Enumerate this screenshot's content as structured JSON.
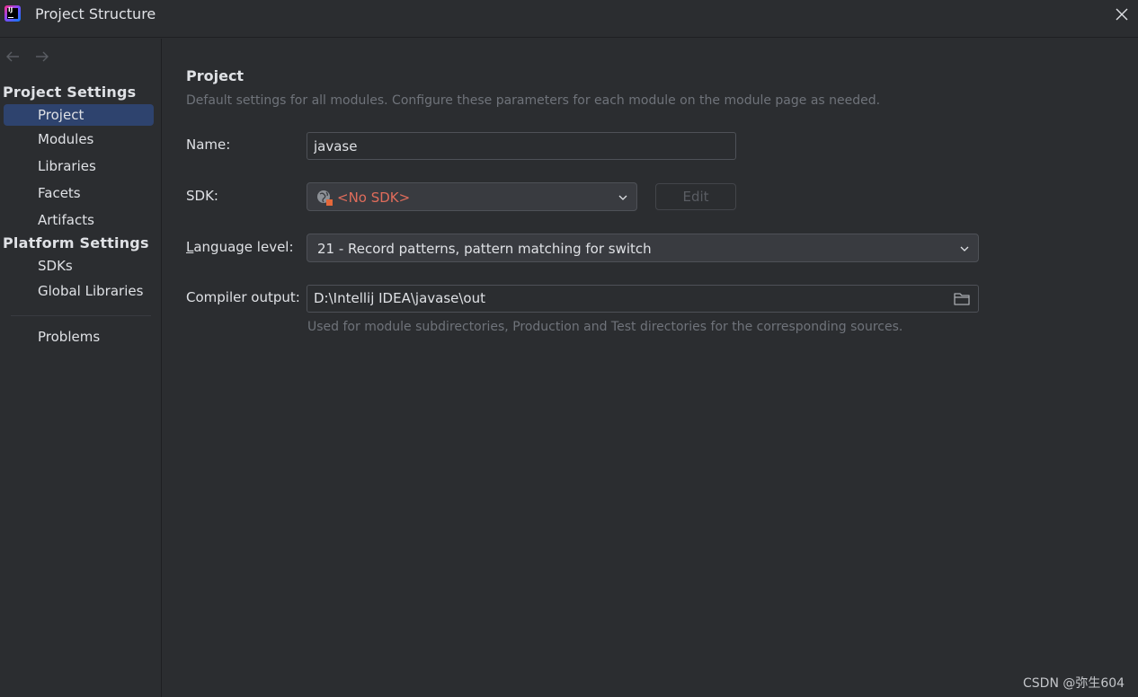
{
  "window": {
    "title": "Project Structure"
  },
  "sidebar": {
    "project_settings_header": "Project Settings",
    "project_items": [
      {
        "label": "Project",
        "selected": true
      },
      {
        "label": "Modules"
      },
      {
        "label": "Libraries"
      },
      {
        "label": "Facets"
      },
      {
        "label": "Artifacts"
      }
    ],
    "platform_settings_header": "Platform Settings",
    "platform_items": [
      {
        "label": "SDKs"
      },
      {
        "label": "Global Libraries"
      }
    ],
    "problems_label": "Problems"
  },
  "main": {
    "title": "Project",
    "subtitle": "Default settings for all modules. Configure these parameters for each module on the module page as needed.",
    "name": {
      "label": "Name:",
      "value": "javase"
    },
    "sdk": {
      "label": "SDK:",
      "value": "<No SDK>",
      "edit_label": "Edit"
    },
    "language_level": {
      "label_first": "L",
      "label_rest": "anguage level:",
      "value": "21 - Record patterns, pattern matching for switch"
    },
    "compiler_output": {
      "label": "Compiler output:",
      "value": "D:\\Intellij IDEA\\javase\\out",
      "help": "Used for module subdirectories, Production and Test directories for the corresponding sources."
    }
  },
  "watermark": "CSDN @弥生604",
  "colors": {
    "background": "#2b2d30",
    "selection": "#2e436e",
    "error_text": "#e06c5b",
    "muted_text": "#6f737a"
  }
}
